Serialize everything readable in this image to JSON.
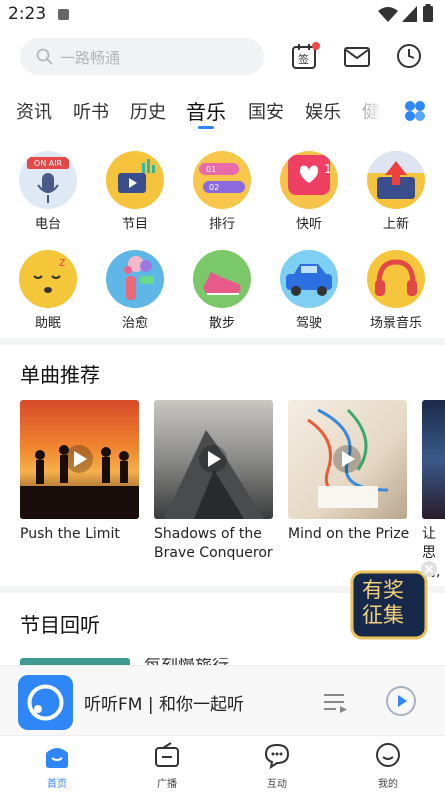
{
  "status_bar": {
    "time": "2:23"
  },
  "search": {
    "placeholder": "一路畅通"
  },
  "header_icons": {
    "checkin_char": "签"
  },
  "tabs": [
    {
      "label": "资讯"
    },
    {
      "label": "听书"
    },
    {
      "label": "历史"
    },
    {
      "label": "音乐"
    },
    {
      "label": "国安"
    },
    {
      "label": "娱乐"
    },
    {
      "label": "健康"
    }
  ],
  "active_tab": "音乐",
  "categories": [
    {
      "label": "电台",
      "icon": "on-air-mic-icon",
      "badge": "ON AIR"
    },
    {
      "label": "节目",
      "icon": "program-tv-icon"
    },
    {
      "label": "排行",
      "icon": "ranking-icon",
      "badge1": "01",
      "badge2": "02"
    },
    {
      "label": "快听",
      "icon": "quick-listen-heart-icon",
      "badge": "1"
    },
    {
      "label": "上新",
      "icon": "new-arrival-icon"
    },
    {
      "label": "助眠",
      "icon": "sleep-face-icon"
    },
    {
      "label": "治愈",
      "icon": "healing-icon"
    },
    {
      "label": "散步",
      "icon": "walk-shoe-icon"
    },
    {
      "label": "驾驶",
      "icon": "car-icon"
    },
    {
      "label": "场景音乐",
      "icon": "headphones-icon"
    }
  ],
  "singles": {
    "title": "单曲推荐",
    "items": [
      {
        "title": "Push the Limit"
      },
      {
        "title": "Shadows of the Brave Conqueror"
      },
      {
        "title": "Mind on the Prize"
      },
      {
        "title": "让思荡,"
      }
    ]
  },
  "replay": {
    "title": "节目回听",
    "peek_text": "每刻慢旅行"
  },
  "promo": {
    "line1": "有奖",
    "line2": "征集"
  },
  "player": {
    "title": "听听FM | 和你一起听"
  },
  "nav": [
    {
      "label": "首页"
    },
    {
      "label": "广播"
    },
    {
      "label": "互动"
    },
    {
      "label": "我的"
    }
  ],
  "colors": {
    "accent": "#2f86f6",
    "promo_gold": "#e8c15a",
    "promo_navy": "#17294a"
  }
}
